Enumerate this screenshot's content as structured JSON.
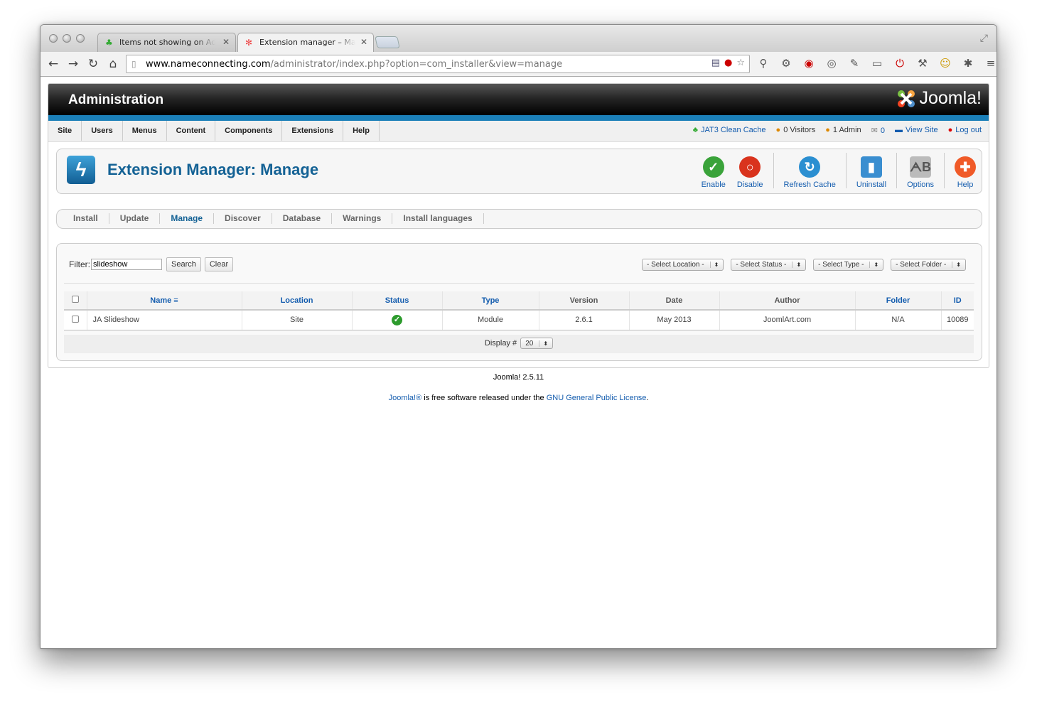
{
  "browser": {
    "tabs": [
      {
        "title": "Items not showing on Adm",
        "favicon": "jat3-icon"
      },
      {
        "title": "Extension manager – Mana",
        "favicon": "joomla-icon"
      }
    ],
    "url_domain": "www.nameconnecting.com",
    "url_path": "/administrator/index.php?option=com_installer&view=manage"
  },
  "header": {
    "title": "Administration",
    "logo": "Joomla!"
  },
  "menu": [
    "Site",
    "Users",
    "Menus",
    "Content",
    "Components",
    "Extensions",
    "Help"
  ],
  "status": {
    "cache": "JAT3 Clean Cache",
    "visitors": "0 Visitors",
    "admins": "1 Admin",
    "messages": "0",
    "view_site": "View Site",
    "logout": "Log out"
  },
  "page_title": "Extension Manager: Manage",
  "toolbar": {
    "enable": "Enable",
    "disable": "Disable",
    "refresh": "Refresh Cache",
    "uninstall": "Uninstall",
    "options": "Options",
    "help": "Help"
  },
  "subnav": [
    "Install",
    "Update",
    "Manage",
    "Discover",
    "Database",
    "Warnings",
    "Install languages"
  ],
  "filter": {
    "label": "Filter:",
    "value": "slideshow",
    "search": "Search",
    "clear": "Clear",
    "location": "- Select Location -",
    "status": "- Select Status -",
    "type": "- Select Type -",
    "folder": "- Select Folder -"
  },
  "table": {
    "headers": {
      "name": "Name",
      "location": "Location",
      "status": "Status",
      "type": "Type",
      "version": "Version",
      "date": "Date",
      "author": "Author",
      "folder": "Folder",
      "id": "ID"
    },
    "row": {
      "name": "JA Slideshow",
      "location": "Site",
      "type": "Module",
      "version": "2.6.1",
      "date": "May 2013",
      "author": "JoomlArt.com",
      "folder": "N/A",
      "id": "10089"
    }
  },
  "pager": {
    "label": "Display #",
    "value": "20"
  },
  "footer": {
    "version": "Joomla! 2.5.11",
    "link1": "Joomla!®",
    "text": " is free software released under the ",
    "link2": "GNU General Public License",
    "end": "."
  },
  "colors": {
    "accent": "#1b7fb8",
    "link": "#135cae",
    "title": "#146295"
  }
}
